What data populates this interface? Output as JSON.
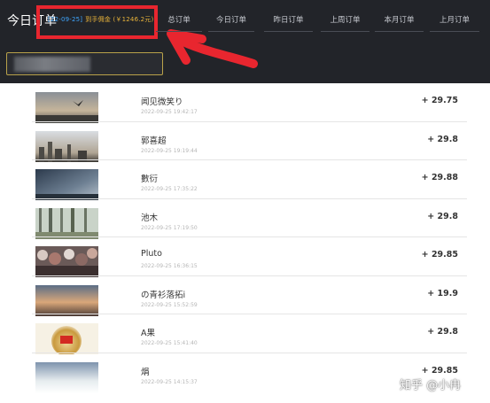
{
  "header": {
    "title": "今日订单",
    "commission_date": "[22-09-25]",
    "commission_text": "到手佣金 (￥1246.2元)",
    "tabs": [
      "总订单",
      "今日订单",
      "昨日订单",
      "上周订单",
      "本月订单",
      "上月订单"
    ]
  },
  "search": {
    "value": ""
  },
  "orders": [
    {
      "name": "闻见微笑り",
      "time": "2022-09-25 19:42:17",
      "amount": "+ 29.75",
      "thumb": "seabird"
    },
    {
      "name": "郭喜超",
      "time": "2022-09-25 19:19:44",
      "amount": "+ 29.8",
      "thumb": "skyline"
    },
    {
      "name": "數衍",
      "time": "2022-09-25 17:35:22",
      "amount": "+ 29.88",
      "thumb": "dusk-sky"
    },
    {
      "name": "池木",
      "time": "2022-09-25 17:19:50",
      "amount": "+ 29.8",
      "thumb": "trees"
    },
    {
      "name": "Pluto",
      "time": "2022-09-25 16:36:15",
      "amount": "+ 29.85",
      "thumb": "crowd"
    },
    {
      "name": "の青衫落拓i",
      "time": "2022-09-25 15:52:59",
      "amount": "+ 19.9",
      "thumb": "sunset-clouds"
    },
    {
      "name": "A果",
      "time": "2022-09-25 15:41:40",
      "amount": "+ 29.8",
      "thumb": "flag-badge"
    },
    {
      "name": "焆",
      "time": "2022-09-25 14:15:37",
      "amount": "+ 29.85",
      "thumb": "bright-sky"
    }
  ],
  "watermark": "知乎 @小冉",
  "colors": {
    "header_bg": "#222429",
    "highlight": "#e8262f",
    "commission_amount": "#e8b33a",
    "commission_date": "#3fa7ff"
  }
}
